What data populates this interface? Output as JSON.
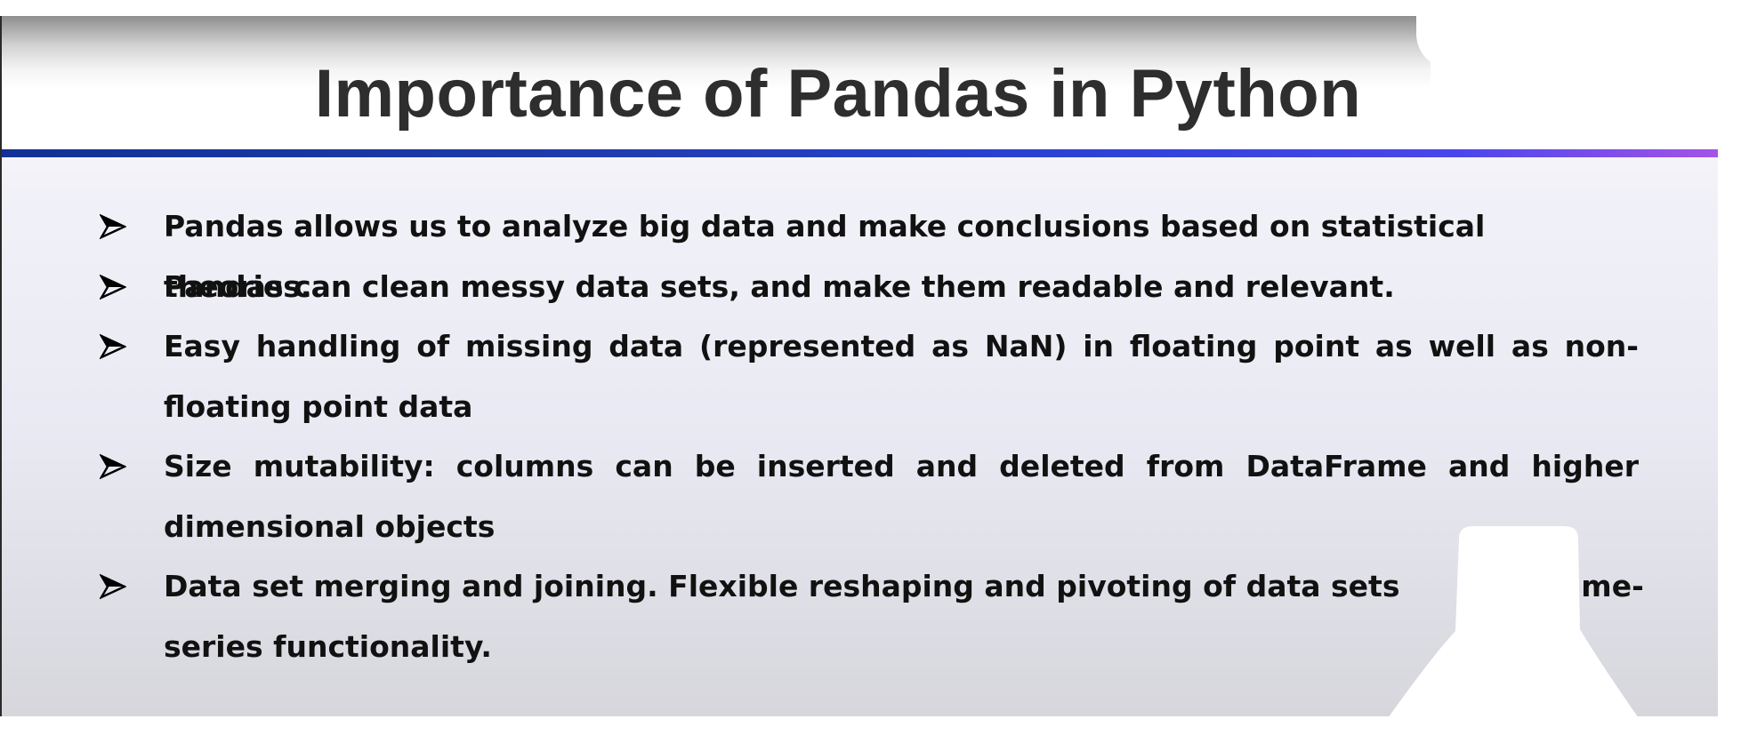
{
  "slide": {
    "title": "Importance of Pandas in Python",
    "bullets": [
      "Pandas allows us to analyze big data and make conclusions based on statistical theories.",
      "Pandas can clean messy data sets, and make them readable and relevant.",
      "Easy handling of missing data (represented as NaN) in floating point as well as non-floating point data",
      "Size mutability: columns can be inserted and deleted from DataFrame and higher dimensional objects",
      "Data set merging and joining. Flexible reshaping and pivoting of data sets Pro",
      "ime-",
      "series functionality."
    ],
    "bullet_icon": "arrowhead-bullet-icon",
    "colors": {
      "title_text": "#2e2e2e",
      "body_text": "#111111",
      "rule_start": "#123196",
      "rule_end": "#a453e8"
    }
  }
}
